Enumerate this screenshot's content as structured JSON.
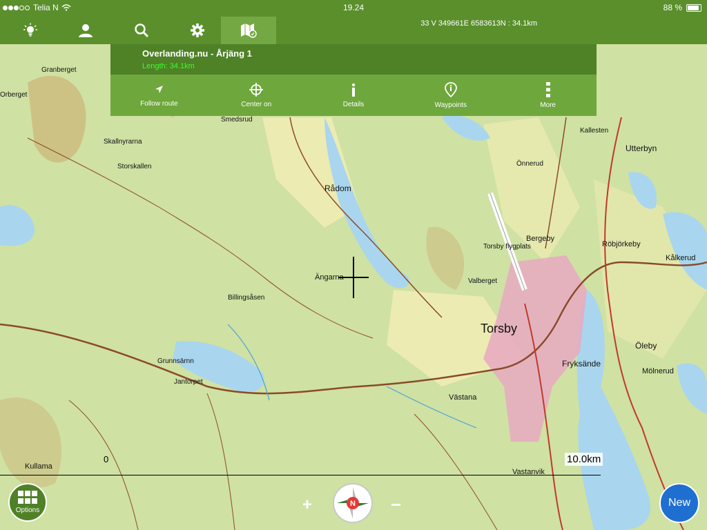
{
  "status_bar": {
    "carrier": "Telia N",
    "time": "19.24",
    "battery": "88 %",
    "icons": [
      "signal-dots-icon",
      "wifi-icon",
      "battery-icon"
    ]
  },
  "toolbar": {
    "items": [
      {
        "name": "lightbulb",
        "icon": "lightbulb-icon"
      },
      {
        "name": "account",
        "icon": "person-icon"
      },
      {
        "name": "search",
        "icon": "search-icon"
      },
      {
        "name": "settings",
        "icon": "gear-icon"
      },
      {
        "name": "map",
        "icon": "map-icon",
        "active": true
      }
    ],
    "coordinates": "33 V 349661E 6583613N : 34.1km"
  },
  "route_panel": {
    "title": "Overlanding.nu - Årjäng 1",
    "length": "Length: 34.1km",
    "actions": [
      {
        "label": "Follow route",
        "icon": "navigate-arrow-icon"
      },
      {
        "label": "Center on",
        "icon": "crosshair-icon"
      },
      {
        "label": "Details",
        "icon": "info-icon"
      },
      {
        "label": "Waypoints",
        "icon": "waypoint-pin-icon"
      },
      {
        "label": "More",
        "icon": "more-vertical-icon"
      }
    ]
  },
  "map": {
    "scale_zero": "0",
    "scale_label": "10.0km",
    "place_names": [
      "Granberget",
      "Orberget",
      "Smedsrud",
      "Rådom",
      "Skallnyrarna",
      "Storskallen",
      "Billingsåsen",
      "Torsby",
      "Fryksände",
      "Önnerud",
      "Utterbyn",
      "Valberget",
      "Torsby flygplats",
      "Bergeby",
      "Kallesten",
      "Öleby",
      "Mölnerud",
      "Västana",
      "Vastanvik",
      "Kullama",
      "Röbjörkeby",
      "Kålkerud",
      "Ängarna",
      "Jantorpet",
      "Grunnsärnn"
    ]
  },
  "bottom_controls": {
    "options_label": "Options",
    "new_label": "New",
    "zoom_in": "+",
    "zoom_out": "−",
    "compass_label": "N"
  },
  "colors": {
    "toolbar": "#5a8f2c",
    "toolbar_active": "#74a843",
    "panel_header": "#4f8127",
    "panel_actions": "#6ea73c",
    "length_text": "#39ff2a",
    "new_button": "#1f6fd0",
    "water": "#a9d6ee",
    "forest": "#c9dea0",
    "road": "#8a4a2a"
  }
}
